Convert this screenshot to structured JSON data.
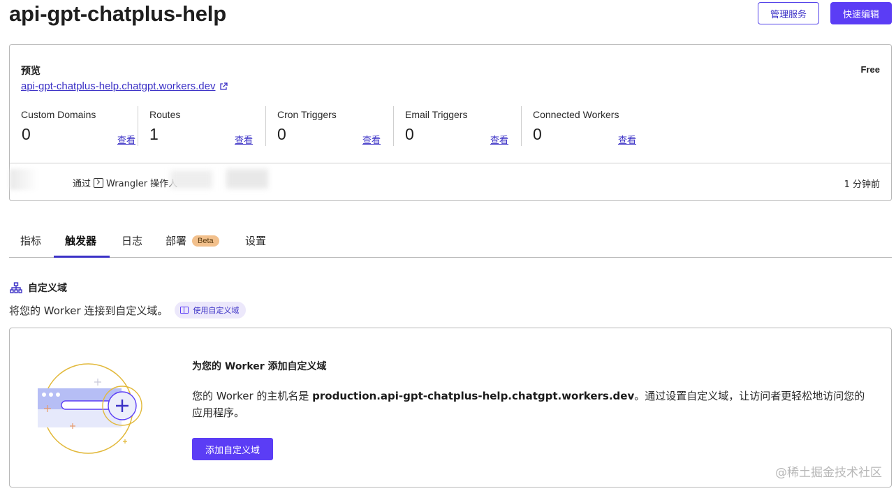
{
  "header": {
    "title": "api-gpt-chatplus-help",
    "manage_label": "管理服务",
    "quick_edit_label": "快速编辑"
  },
  "overview": {
    "preview_label": "预览",
    "preview_url": "api-gpt-chatplus-help.chatgpt.workers.dev",
    "plan": "Free",
    "stats": [
      {
        "label": "Custom Domains",
        "value": "0",
        "link": "查看"
      },
      {
        "label": "Routes",
        "value": "1",
        "link": "查看"
      },
      {
        "label": "Cron Triggers",
        "value": "0",
        "link": "查看"
      },
      {
        "label": "Email Triggers",
        "value": "0",
        "link": "查看"
      },
      {
        "label": "Connected Workers",
        "value": "0",
        "link": "查看"
      }
    ],
    "deploy_prefix": "通过",
    "deploy_tool": "Wrangler 操作人",
    "deploy_time": "1 分钟前"
  },
  "tabs": [
    {
      "label": "指标"
    },
    {
      "label": "触发器",
      "active": true
    },
    {
      "label": "日志"
    },
    {
      "label": "部署",
      "badge": "Beta"
    },
    {
      "label": "设置"
    }
  ],
  "custom_domain": {
    "title": "自定义域",
    "description": "将您的 Worker 连接到自定义域。",
    "doc_link": "使用自定义域",
    "card_title": "为您的 Worker 添加自定义域",
    "body_prefix": "您的 Worker 的主机名是 ",
    "hostname": "production.api-gpt-chatplus-help.chatgpt.workers.dev",
    "body_suffix": "。通过设置自定义域，让访问者更轻松地访问您的应用程序。",
    "button": "添加自定义域"
  },
  "watermark": "@稀土掘金技术社区",
  "colors": {
    "accent": "#5b3df5",
    "link": "#3b31c6",
    "beta": "#f2c08c"
  }
}
